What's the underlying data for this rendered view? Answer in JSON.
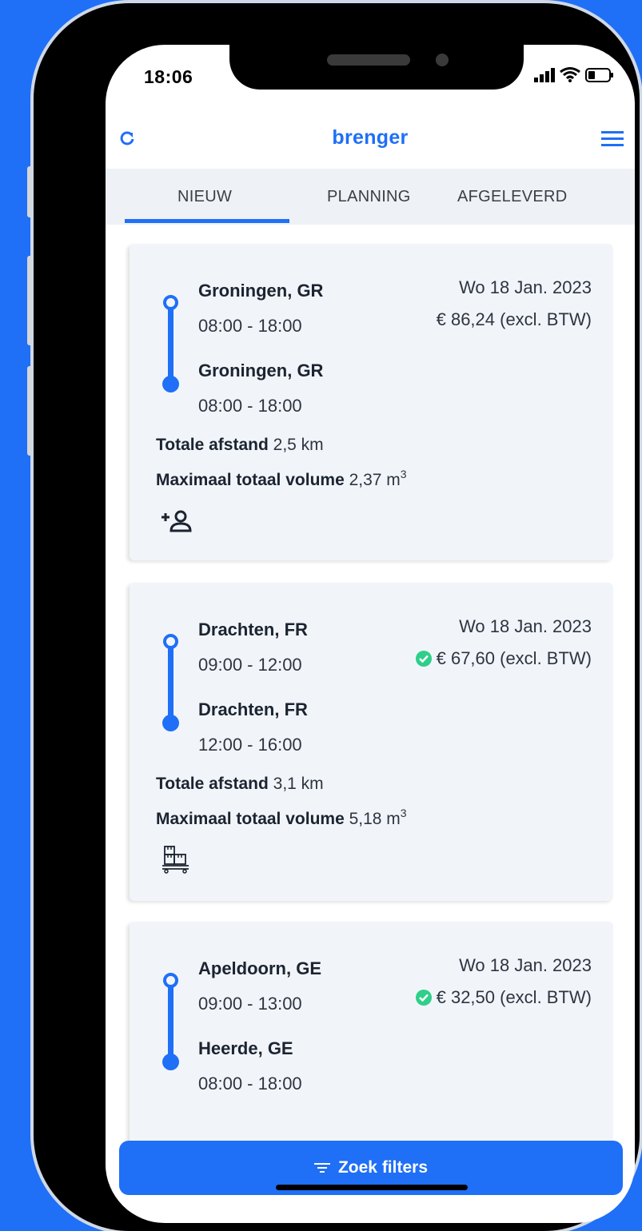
{
  "status_bar": {
    "time": "18:06"
  },
  "app": {
    "logo": "brenger"
  },
  "tabs": [
    {
      "label": "NIEUW",
      "active": true
    },
    {
      "label": "PLANNING",
      "active": false
    },
    {
      "label": "AFGELEVERD",
      "active": false
    }
  ],
  "jobs": [
    {
      "pickup_city": "Groningen, GR",
      "pickup_hours": "08:00 - 18:00",
      "delivery_city": "Groningen, GR",
      "delivery_hours": "08:00 - 18:00",
      "date": "Wo 18 Jan. 2023",
      "price": "€ 86,24 (excl. BTW)",
      "verified": false,
      "distance_label": "Totale afstand",
      "distance_value": "2,5 km",
      "volume_label": "Maximaal totaal volume",
      "volume_value": "2,37 m",
      "volume_unit_power": "3",
      "extra_icon": "add-person-icon"
    },
    {
      "pickup_city": "Drachten, FR",
      "pickup_hours": "09:00 - 12:00",
      "delivery_city": "Drachten, FR",
      "delivery_hours": "12:00 - 16:00",
      "date": "Wo 18 Jan. 2023",
      "price": "€ 67,60 (excl. BTW)",
      "verified": true,
      "distance_label": "Totale afstand",
      "distance_value": "3,1 km",
      "volume_label": "Maximaal totaal volume",
      "volume_value": "5,18 m",
      "volume_unit_power": "3",
      "extra_icon": "pallet-boxes-icon"
    },
    {
      "pickup_city": "Apeldoorn, GE",
      "pickup_hours": "09:00 - 13:00",
      "delivery_city": "Heerde, GE",
      "delivery_hours": "08:00 - 18:00",
      "date": "Wo 18 Jan. 2023",
      "price": "€ 32,50 (excl. BTW)",
      "verified": true
    }
  ],
  "filter_button": {
    "label": "Zoek filters"
  },
  "colors": {
    "brand": "#1f6ff7",
    "verified": "#2ecf8a",
    "card_bg": "#f1f5fa"
  }
}
